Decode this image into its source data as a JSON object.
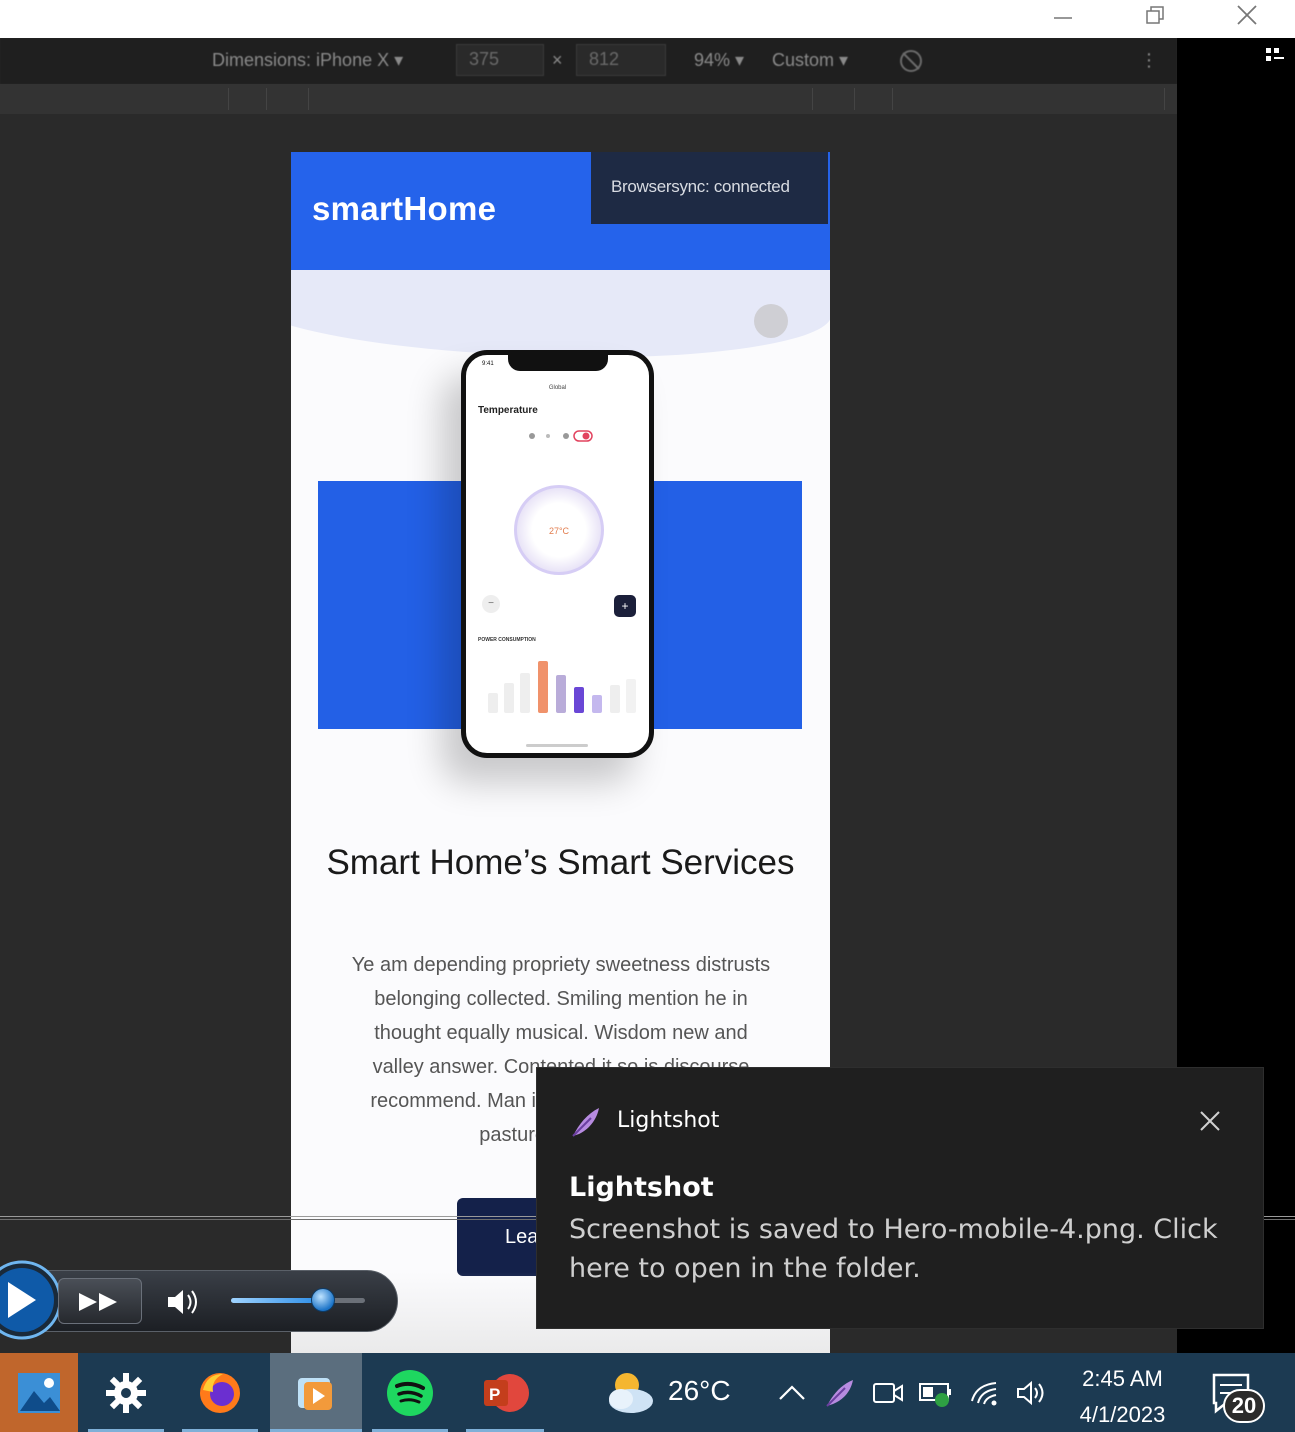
{
  "devtools": {
    "dimensions_label": "Dimensions: iPhone X ▾",
    "width": "375",
    "times": "×",
    "height": "812",
    "zoom": "94% ▾",
    "throttle": "Custom ▾",
    "more": "⋮"
  },
  "site": {
    "brand": "smartHome",
    "browsersync": "Browsersync: connected",
    "heading": "Smart Home’s Smart Services",
    "body_lines": [
      "Ye am depending propriety sweetness distrusts",
      "belonging collected. Smiling mention he in",
      "thought equally musical. Wisdom new and",
      "valley answer. Contented it so is discourse",
      "recommend. Man its upon him call mile. An",
      "pasture he himself",
      "co"
    ],
    "cta_label": "Lea",
    "phone": {
      "status_time": "9:41",
      "screen_title": "Global",
      "section": "Temperature",
      "dial_value": "27°C",
      "caption": "POWER CONSUMPTION"
    }
  },
  "toast": {
    "app_name": "Lightshot",
    "title": "Lightshot",
    "message": "Screenshot is saved to Hero-mobile-4.png. Click here to open in the folder."
  },
  "taskbar": {
    "weather_temp": "26°C",
    "time": "2:45 AM",
    "date": "4/1/2023",
    "notification_count": "20"
  },
  "media_player": {
    "volume_fraction": 0.65
  },
  "colors": {
    "brand_blue": "#2563eb",
    "taskbar": "#1c3a52",
    "toast_bg": "#1f1f1f"
  }
}
